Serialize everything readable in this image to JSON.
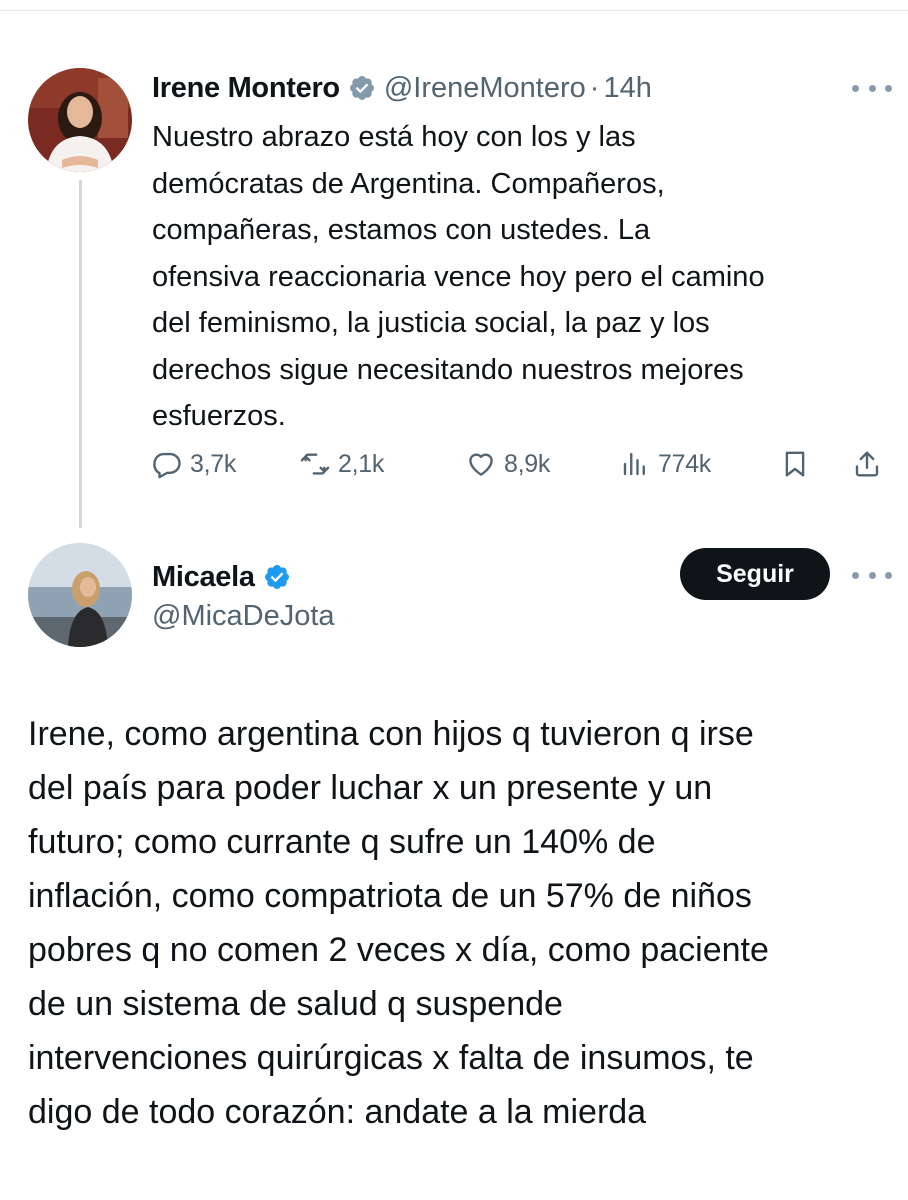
{
  "tweet": {
    "author_name": "Irene Montero",
    "author_handle": "@IreneMontero",
    "separator": "·",
    "time": "14h",
    "verified_icon": "verified-badge-icon",
    "text_lines": [
      "Nuestro abrazo está hoy con los y las",
      "demócratas de Argentina. Compañeros,",
      "compañeras, estamos con ustedes. La",
      "ofensiva reaccionaria vence hoy pero el camino",
      "del feminismo, la justicia social, la paz y los",
      "derechos sigue necesitando nuestros mejores",
      "esfuerzos."
    ],
    "stats": {
      "replies": "3,7k",
      "retweets": "2,1k",
      "likes": "8,9k",
      "views": "774k"
    }
  },
  "reply": {
    "author_name": "Micaela",
    "author_handle": "@MicaDeJota",
    "follow_label": "Seguir",
    "verified_icon": "verified-badge-icon",
    "text_lines": [
      "Irene, como argentina con hijos q tuvieron q irse",
      "del país para poder luchar x un presente y un",
      "futuro; como currante q sufre un 140% de",
      "inflación, como compatriota de un 57% de niños",
      "pobres q no comen 2 veces x día, como paciente",
      "de un sistema de salud q suspende",
      "intervenciones quirúrgicas x falta de insumos, te",
      "digo de todo corazón: andate a la mierda"
    ]
  },
  "colors": {
    "text": "#0f1419",
    "secondary": "#536471",
    "thread_line": "#cfd9de",
    "verified_blue": "#1d9bf0",
    "verified_gray": "#829aab",
    "button_bg": "#0f1419"
  }
}
